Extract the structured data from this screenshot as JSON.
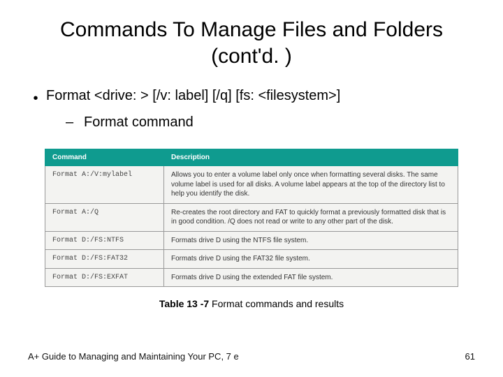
{
  "title": "Commands To Manage Files and Folders (cont'd. )",
  "bullet1": "Format <drive: > [/v: label] [/q] [fs: <filesystem>]",
  "bullet2": "Format command",
  "table": {
    "headers": [
      "Command",
      "Description"
    ],
    "rows": [
      {
        "cmd": "Format A:/V:mylabel",
        "desc": "Allows you to enter a volume label only once when formatting several disks. The same volume label is used for all disks. A volume label appears at the top of the directory list to help you identify the disk."
      },
      {
        "cmd": "Format A:/Q",
        "desc": "Re-creates the root directory and FAT to quickly format a previously formatted disk that is in good condition. /Q does not read or write to any other part of the disk."
      },
      {
        "cmd": "Format D:/FS:NTFS",
        "desc": "Formats drive D using the NTFS file system."
      },
      {
        "cmd": "Format D:/FS:FAT32",
        "desc": "Formats drive D using the FAT32 file system."
      },
      {
        "cmd": "Format D:/FS:EXFAT",
        "desc": "Formats drive D using the extended FAT file system."
      }
    ]
  },
  "caption_label": "Table 13 -7",
  "caption_text": " Format commands and results",
  "footer_left": "A+ Guide to Managing and Maintaining Your PC, 7 e",
  "footer_right": "61"
}
